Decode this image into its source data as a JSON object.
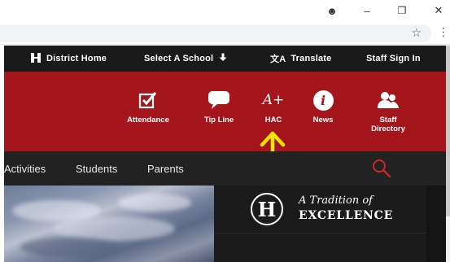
{
  "browser": {
    "window_controls": {
      "account": "☻",
      "minimize": "–",
      "restore": "❐",
      "close": "✕"
    },
    "bookmark_icon": "☆",
    "menu_icon": "⋮"
  },
  "utility_bar": {
    "items": [
      {
        "icon": "building-icon",
        "label": "District Home"
      },
      {
        "label": "Select A School",
        "suffix_icon": "arrow-down-icon"
      },
      {
        "icon": "translate-icon",
        "label": "Translate"
      },
      {
        "label": "Staff Sign In"
      }
    ]
  },
  "quick_links": [
    {
      "icon": "checkbox-icon",
      "label": "Attendance"
    },
    {
      "icon": "speech-bubble-icon",
      "label": "Tip Line"
    },
    {
      "icon": "a-plus-icon",
      "icon_text": "A+",
      "label": "HAC"
    },
    {
      "icon": "info-icon",
      "icon_text": "i",
      "label": "News"
    },
    {
      "icon": "people-icon",
      "label": "Staff\nDirectory"
    }
  ],
  "main_nav": {
    "items": [
      "Activities",
      "Students",
      "Parents"
    ],
    "search_icon": "search-icon"
  },
  "hero": {
    "crest_letter": "H",
    "tagline": "A Tradition of",
    "headline": "EXCELLENCE"
  },
  "colors": {
    "utility_bar": "#1a1a1a",
    "red_band": "#a5161c",
    "main_nav": "#222222",
    "search_icon": "#d02626",
    "annotation_arrow": "#f5e400"
  }
}
